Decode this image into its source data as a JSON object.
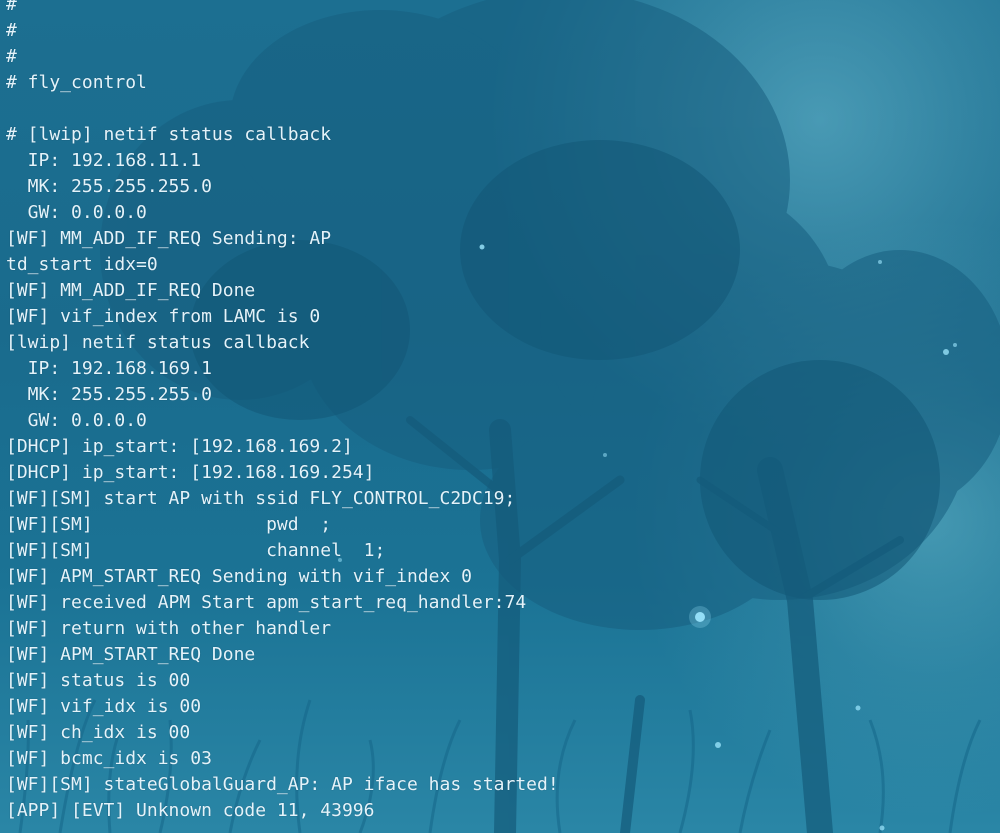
{
  "terminal": {
    "lines": [
      "#",
      "#",
      "#",
      "# fly_control",
      "",
      "# [lwip] netif status callback",
      "  IP: 192.168.11.1",
      "  MK: 255.255.255.0",
      "  GW: 0.0.0.0",
      "[WF] MM_ADD_IF_REQ Sending: AP",
      "td_start idx=0",
      "[WF] MM_ADD_IF_REQ Done",
      "[WF] vif_index from LAMC is 0",
      "[lwip] netif status callback",
      "  IP: 192.168.169.1",
      "  MK: 255.255.255.0",
      "  GW: 0.0.0.0",
      "[DHCP] ip_start: [192.168.169.2]",
      "[DHCP] ip_start: [192.168.169.254]",
      "[WF][SM] start AP with ssid FLY_CONTROL_C2DC19;",
      "[WF][SM]                pwd  ;",
      "[WF][SM]                channel  1;",
      "[WF] APM_START_REQ Sending with vif_index 0",
      "[WF] received APM Start apm_start_req_handler:74",
      "[WF] return with other handler",
      "[WF] APM_START_REQ Done",
      "[WF] status is 00",
      "[WF] vif_idx is 00",
      "[WF] ch_idx is 00",
      "[WF] bcmc_idx is 03",
      "[WF][SM] stateGlobalGuard_AP: AP iface has started!",
      "[APP] [EVT] Unknown code 11, 43996"
    ]
  },
  "colors": {
    "text": "#e4f3fa",
    "background": "#1b6f93",
    "tree_silhouette": "#155f80",
    "firefly": "#9fe8ff"
  }
}
